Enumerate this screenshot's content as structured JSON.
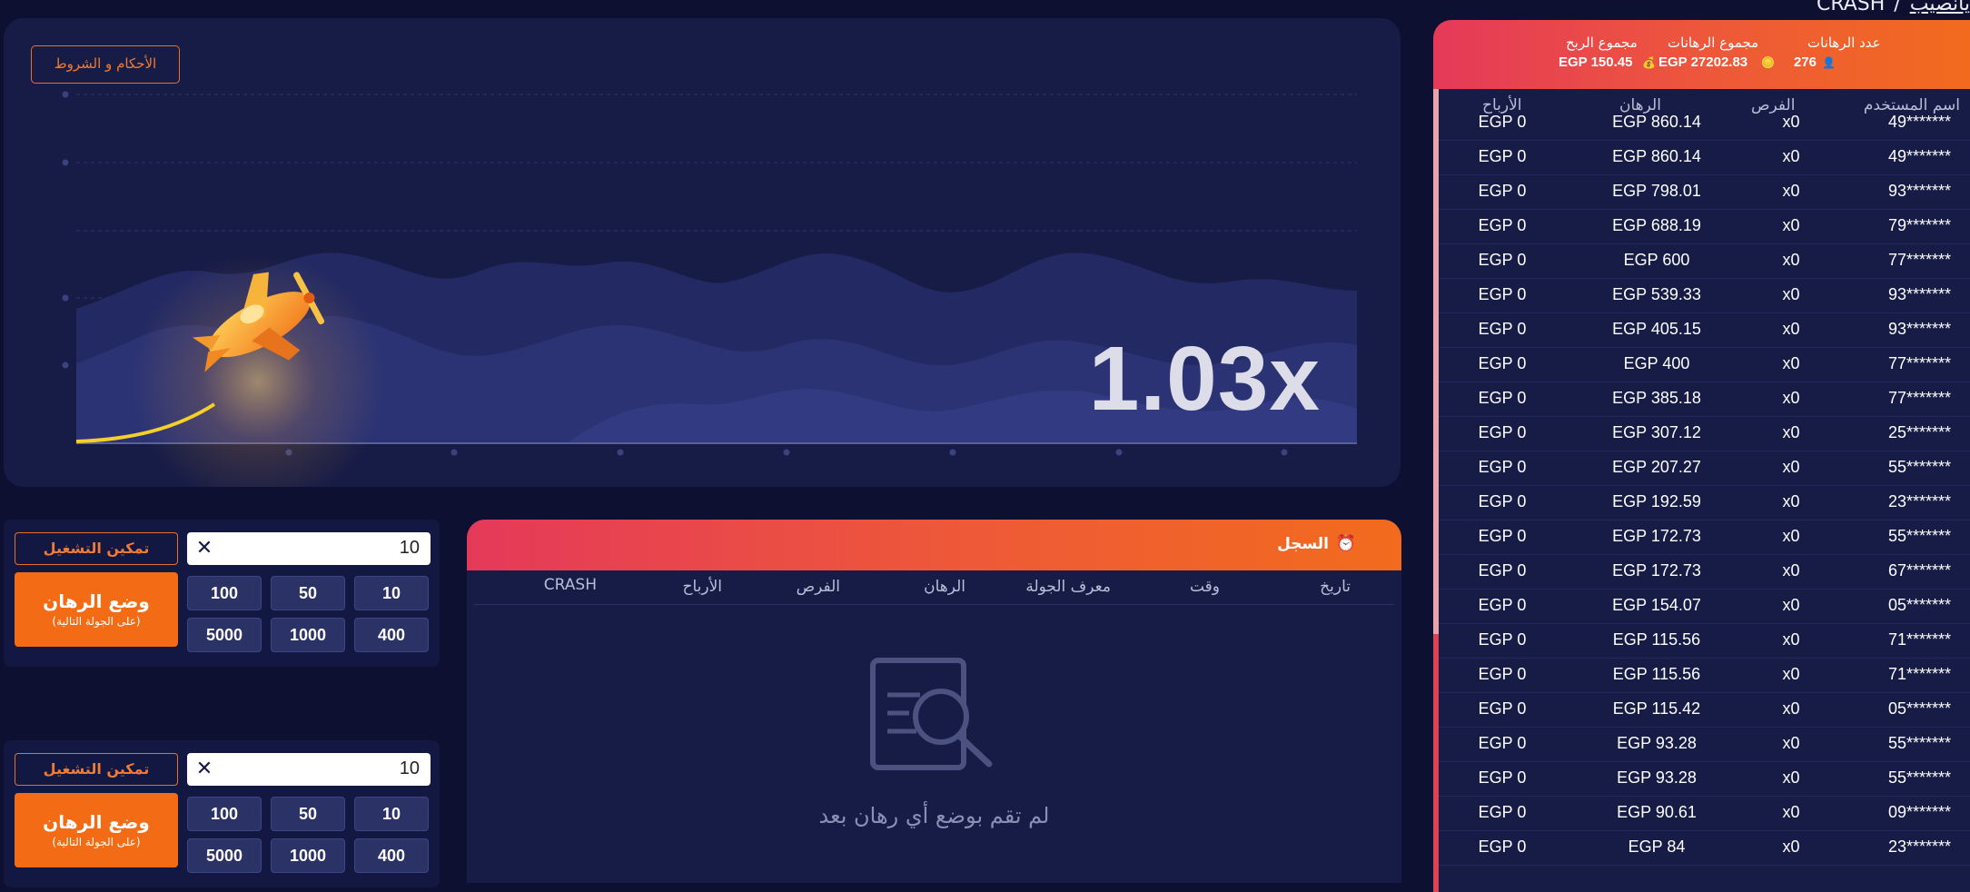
{
  "breadcrumb": {
    "current": "CRASH",
    "separator": "/",
    "link": "يانصيب"
  },
  "game": {
    "terms_label": "الأحكام و الشروط",
    "multiplier": "1.03x"
  },
  "bet_panels": [
    {
      "autoplay_label": "تمكين التشغيل التلقائي",
      "amount": "10",
      "place_bet_label": "وضع الرهان",
      "place_bet_sub": "(على الجولة التالية)",
      "chips": [
        "100",
        "50",
        "10",
        "5000",
        "1000",
        "400"
      ]
    },
    {
      "autoplay_label": "تمكين التشغيل التلقائي",
      "amount": "10",
      "place_bet_label": "وضع الرهان",
      "place_bet_sub": "(على الجولة التالية)",
      "chips": [
        "100",
        "50",
        "10",
        "5000",
        "1000",
        "400"
      ]
    }
  ],
  "history": {
    "title": "السجل",
    "icon": "alarm-clock-icon",
    "columns": [
      "تاريخ",
      "وقت",
      "معرف الجولة",
      "الرهان",
      "الفرص",
      "الأرباح",
      "CRASH"
    ],
    "empty_text": "لم تقم بوضع أي رهان بعد"
  },
  "stats": {
    "bets_count_label": "عدد الرهانات",
    "bets_count": "276",
    "bets_total_label": "مجموع الرهانات",
    "bets_total": "EGP 27202.83",
    "win_total_label": "مجموع الربح",
    "win_total": "EGP 150.45"
  },
  "bets_table": {
    "columns": {
      "user": "اسم المستخدم",
      "odds": "الفرص",
      "bet": "الرهان",
      "win": "الأرباح"
    },
    "rows": [
      {
        "user": "49*******",
        "odds": "x0",
        "bet": "EGP 860.14",
        "win": "EGP 0"
      },
      {
        "user": "49*******",
        "odds": "x0",
        "bet": "EGP 860.14",
        "win": "EGP 0"
      },
      {
        "user": "93*******",
        "odds": "x0",
        "bet": "EGP 798.01",
        "win": "EGP 0"
      },
      {
        "user": "79*******",
        "odds": "x0",
        "bet": "EGP 688.19",
        "win": "EGP 0"
      },
      {
        "user": "77*******",
        "odds": "x0",
        "bet": "EGP 600",
        "win": "EGP 0"
      },
      {
        "user": "93*******",
        "odds": "x0",
        "bet": "EGP 539.33",
        "win": "EGP 0"
      },
      {
        "user": "93*******",
        "odds": "x0",
        "bet": "EGP 405.15",
        "win": "EGP 0"
      },
      {
        "user": "77*******",
        "odds": "x0",
        "bet": "EGP 400",
        "win": "EGP 0"
      },
      {
        "user": "77*******",
        "odds": "x0",
        "bet": "EGP 385.18",
        "win": "EGP 0"
      },
      {
        "user": "25*******",
        "odds": "x0",
        "bet": "EGP 307.12",
        "win": "EGP 0"
      },
      {
        "user": "55*******",
        "odds": "x0",
        "bet": "EGP 207.27",
        "win": "EGP 0"
      },
      {
        "user": "23*******",
        "odds": "x0",
        "bet": "EGP 192.59",
        "win": "EGP 0"
      },
      {
        "user": "55*******",
        "odds": "x0",
        "bet": "EGP 172.73",
        "win": "EGP 0"
      },
      {
        "user": "67*******",
        "odds": "x0",
        "bet": "EGP 172.73",
        "win": "EGP 0"
      },
      {
        "user": "05*******",
        "odds": "x0",
        "bet": "EGP 154.07",
        "win": "EGP 0"
      },
      {
        "user": "71*******",
        "odds": "x0",
        "bet": "EGP 115.56",
        "win": "EGP 0"
      },
      {
        "user": "71*******",
        "odds": "x0",
        "bet": "EGP 115.56",
        "win": "EGP 0"
      },
      {
        "user": "05*******",
        "odds": "x0",
        "bet": "EGP 115.42",
        "win": "EGP 0"
      },
      {
        "user": "55*******",
        "odds": "x0",
        "bet": "EGP 93.28",
        "win": "EGP 0"
      },
      {
        "user": "55*******",
        "odds": "x0",
        "bet": "EGP 93.28",
        "win": "EGP 0"
      },
      {
        "user": "09*******",
        "odds": "x0",
        "bet": "EGP 90.61",
        "win": "EGP 0"
      },
      {
        "user": "23*******",
        "odds": "x0",
        "bet": "EGP 84",
        "win": "EGP 0"
      }
    ]
  },
  "colors": {
    "background": "#0d1030",
    "panel": "#171c46",
    "accent": "#f36b14",
    "header_gradient_start": "#e5395a",
    "header_gradient_end": "#f26b1d"
  }
}
